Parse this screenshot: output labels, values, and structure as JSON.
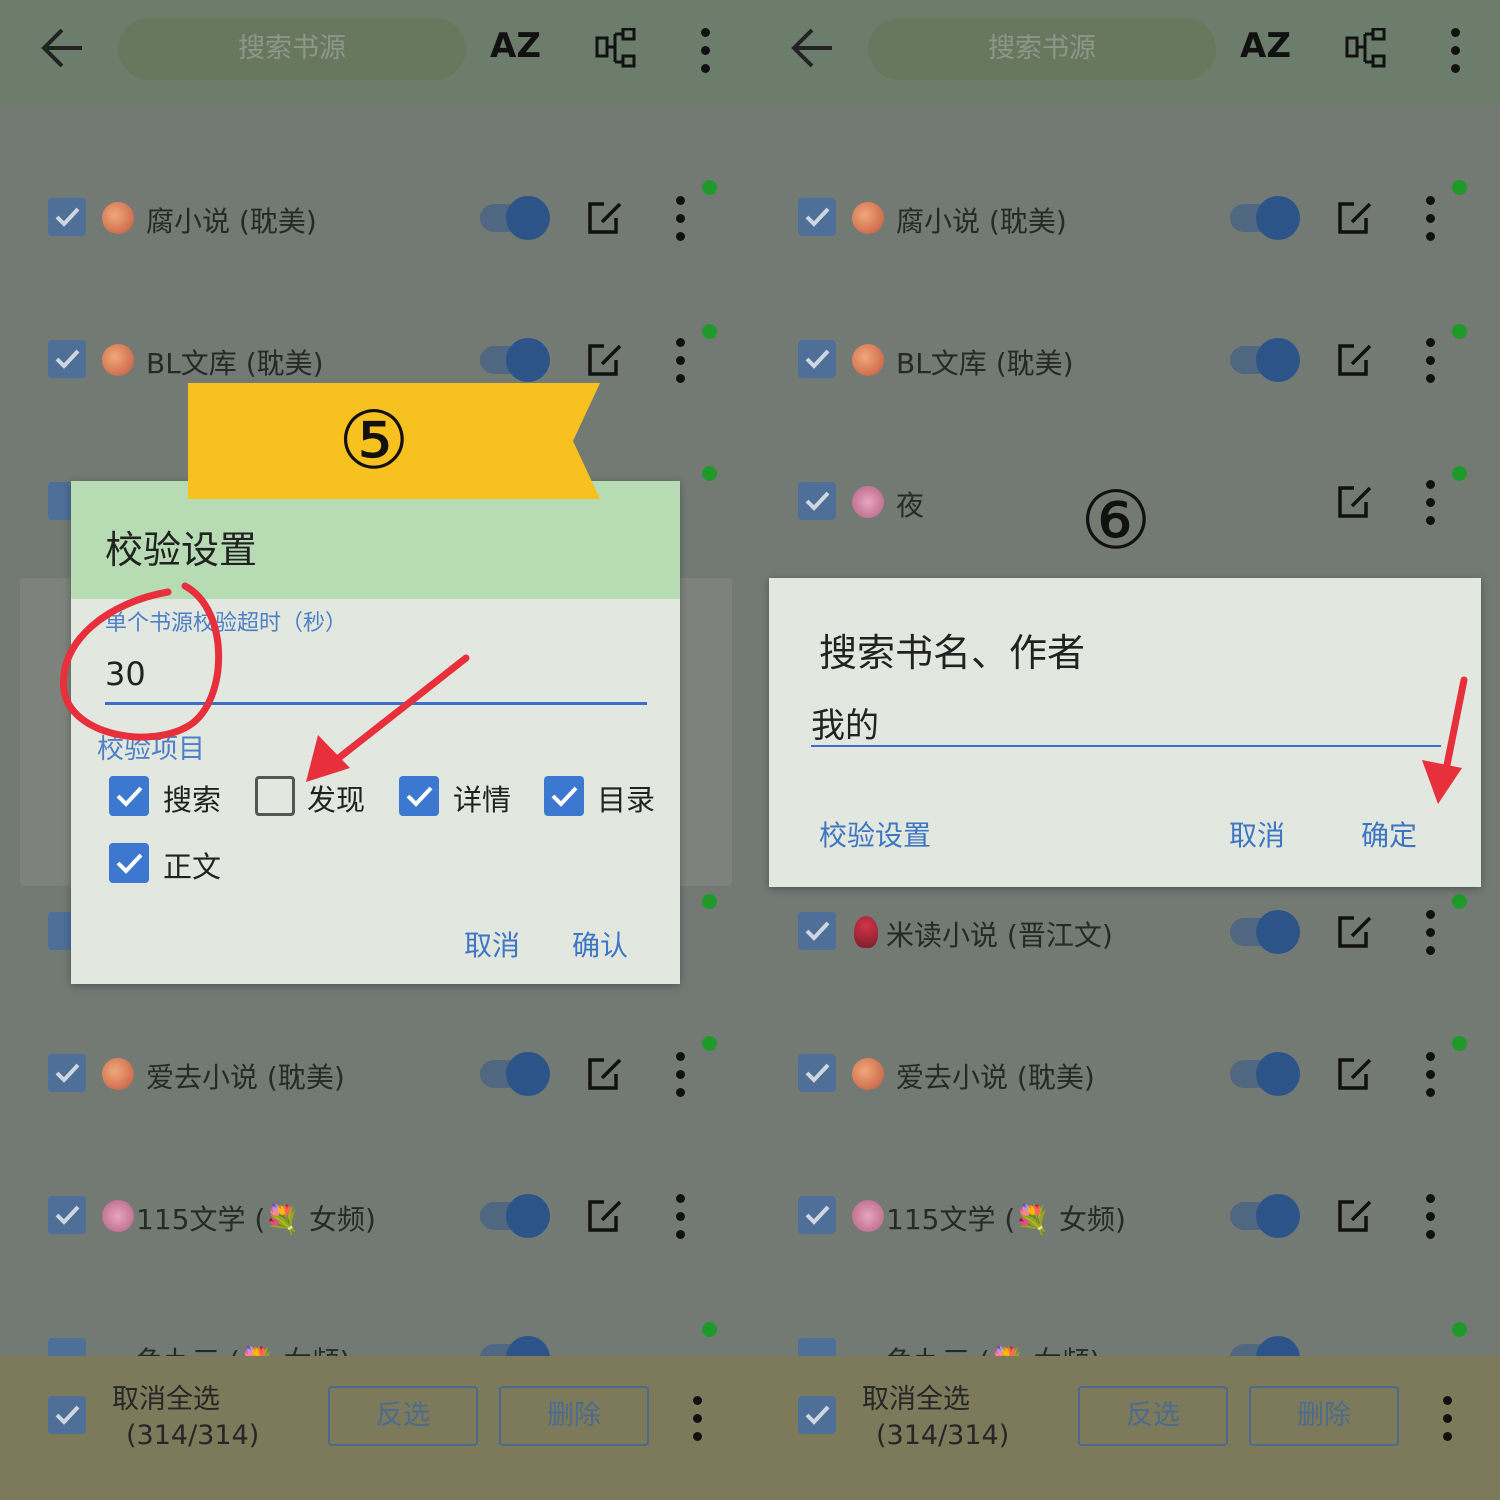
{
  "header": {
    "search_placeholder": "搜索书源",
    "sort_label": "AZ"
  },
  "sources_left": [
    {
      "name": "腐小说 (耽美)",
      "icon": "peach-icon"
    },
    {
      "name": "BL文库 (耽美)",
      "icon": "peach-icon"
    },
    {
      "name": "爱去小说 (耽美)",
      "icon": "peach-icon"
    },
    {
      "name": "115文学 (💐 女频)",
      "icon": "flower-icon"
    },
    {
      "name": "鱼九三 (💐 女频)",
      "icon": "flower-icon"
    }
  ],
  "sources_right": [
    {
      "name": "腐小说 (耽美)",
      "icon": "peach-icon"
    },
    {
      "name": "BL文库 (耽美)",
      "icon": "peach-icon"
    },
    {
      "name": "夜",
      "icon": "flower-icon"
    },
    {
      "name": "米读小说 (晋江文)",
      "icon": "tulip-icon"
    },
    {
      "name": "爱去小说 (耽美)",
      "icon": "peach-icon"
    },
    {
      "name": "115文学 (💐 女频)",
      "icon": "flower-icon"
    },
    {
      "name": "鱼九三 (💐 女频)",
      "icon": "flower-icon"
    }
  ],
  "bottom": {
    "deselect_line1": "取消全选",
    "deselect_line2": "(314/314)",
    "invert": "反选",
    "delete": "删除"
  },
  "step5": {
    "badge": "⑤",
    "title": "校验设置",
    "timeout_label": "单个书源校验超时（秒）",
    "timeout_value": "30",
    "items_label": "校验项目",
    "items": [
      {
        "label": "搜索",
        "checked": true
      },
      {
        "label": "发现",
        "checked": false
      },
      {
        "label": "详情",
        "checked": true
      },
      {
        "label": "目录",
        "checked": true
      },
      {
        "label": "正文",
        "checked": true
      }
    ],
    "cancel": "取消",
    "confirm": "确认"
  },
  "step6": {
    "badge": "⑥",
    "title": "搜索书名、作者",
    "input_value": "我的",
    "settings": "校验设置",
    "cancel": "取消",
    "ok": "确定"
  },
  "colors": {
    "accent": "#3c78cf",
    "flag": "#f7c11f",
    "annotation": "#e8303d",
    "online": "#1f9a2a"
  }
}
